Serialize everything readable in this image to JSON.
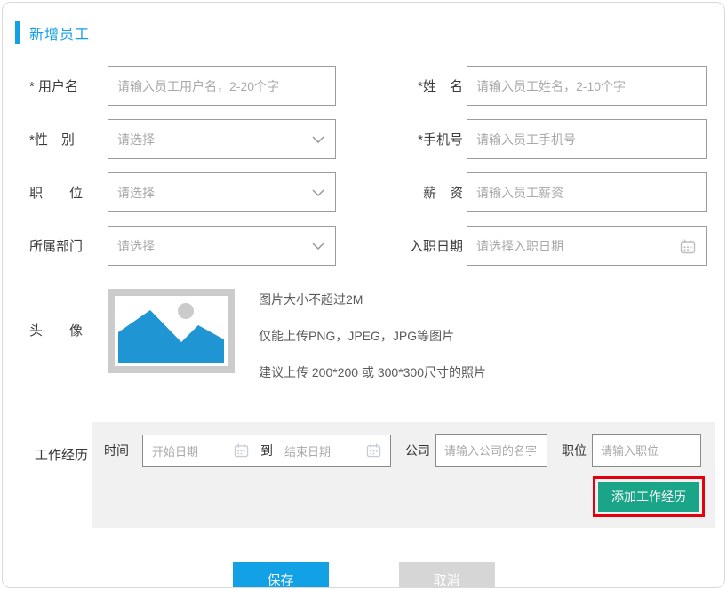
{
  "colors": {
    "accent_blue": "#12a1e4",
    "add_button_green": "#1aa588",
    "annotation_red": "#e3000f",
    "cancel_gray": "#d6d6d6",
    "panel_gray": "#f1f1f1",
    "image_placeholder_blue": "#2095d3"
  },
  "header": {
    "title": "新增员工"
  },
  "form": {
    "username": {
      "label": "* 用户名",
      "placeholder": "请输入员工用户名，2-20个字"
    },
    "name": {
      "label": "*姓　名",
      "placeholder": "请输入员工姓名，2-10个字"
    },
    "gender": {
      "label": "*性　别",
      "placeholder": "请选择"
    },
    "phone": {
      "label": "*手机号",
      "placeholder": "请输入员工手机号"
    },
    "position": {
      "label": "职　　位",
      "placeholder": "请选择"
    },
    "salary": {
      "label": "薪　资",
      "placeholder": "请输入员工薪资"
    },
    "department": {
      "label": "所属部门",
      "placeholder": "请选择"
    },
    "hire_date": {
      "label": "入职日期",
      "placeholder": "请选择入职日期"
    },
    "avatar": {
      "label": "头　　像",
      "hints": [
        "图片大小不超过2M",
        "仅能上传PNG，JPEG，JPG等图片",
        "建议上传 200*200 或 300*300尺寸的照片"
      ]
    },
    "work_experience": {
      "label": "工作经历",
      "time_label": "时间",
      "start_placeholder": "开始日期",
      "to_label": "到",
      "end_placeholder": "结束日期",
      "company_label": "公司",
      "company_placeholder": "请输入公司的名字",
      "job_label": "职位",
      "job_placeholder": "请输入职位",
      "add_button_label": "添加工作经历"
    }
  },
  "footer": {
    "save_label": "保存",
    "cancel_label": "取消"
  }
}
